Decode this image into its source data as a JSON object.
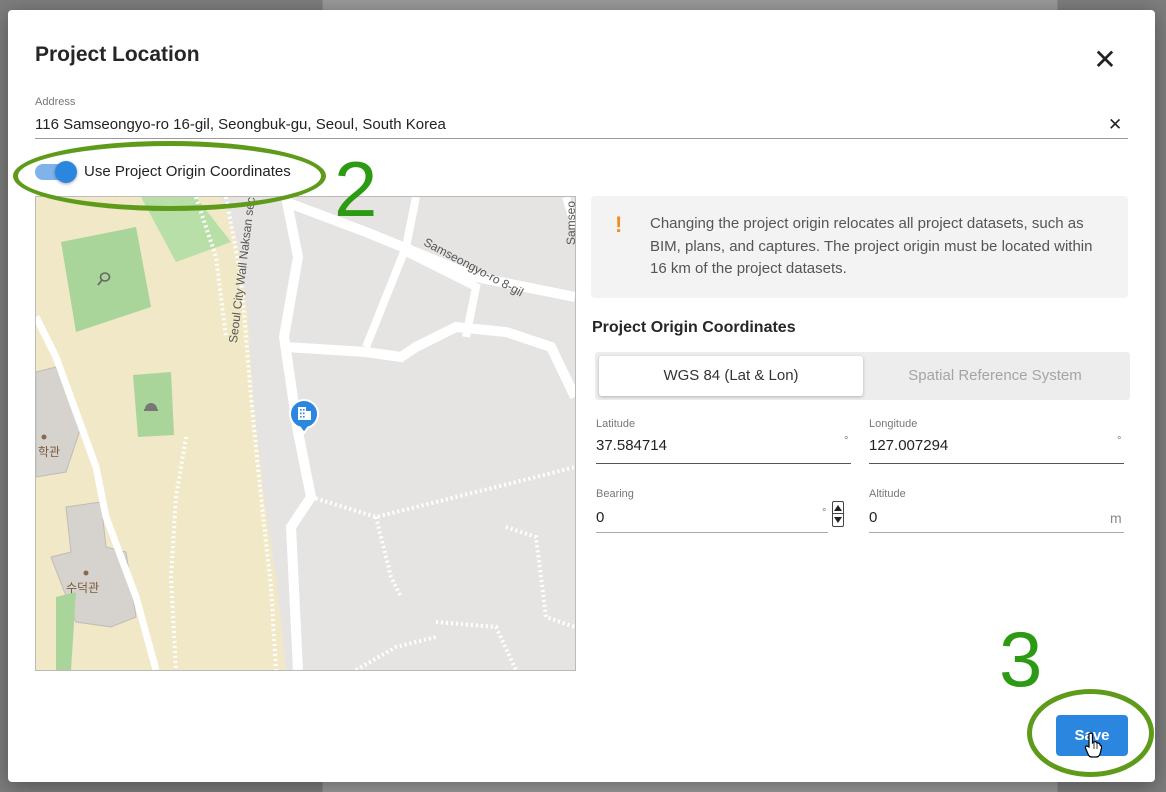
{
  "dialog": {
    "title": "Project Location",
    "close_symbol": "✕",
    "address": {
      "label": "Address",
      "value": "116 Samseongyo-ro 16-gil, Seongbuk-gu, Seoul, South Korea",
      "clear_symbol": "✕"
    },
    "toggle": {
      "label": "Use Project Origin Coordinates",
      "on": true
    },
    "map": {
      "labels": {
        "road_top": "Samseongyo-ro 8-gil",
        "road_side": "Seoul City Wall Naksan section",
        "road_edge": "Samseo",
        "building_1": "학관",
        "building_2": "수덕관"
      },
      "icons": [
        "tennis-icon",
        "helmet-icon",
        "office-building-pin-icon"
      ]
    },
    "info": {
      "icon": "!",
      "text": "Changing the project origin relocates all project datasets, such as BIM, plans, and captures. The project origin must be located within 16 km of the project datasets."
    },
    "coords": {
      "title": "Project Origin Coordinates",
      "tabs": [
        {
          "label": "WGS 84 (Lat & Lon)",
          "active": true
        },
        {
          "label": "Spatial Reference System",
          "active": false
        }
      ],
      "latitude": {
        "label": "Latitude",
        "value": "37.584714",
        "unit": "°"
      },
      "longitude": {
        "label": "Longitude",
        "value": "127.007294",
        "unit": "°"
      },
      "bearing": {
        "label": "Bearing",
        "value": "0",
        "unit": "°"
      },
      "altitude": {
        "label": "Altitude",
        "value": "0",
        "unit": "m"
      }
    },
    "save_label": "Save"
  },
  "annotations": {
    "step_2": "2",
    "step_3": "3",
    "color": "#5f9b1a"
  },
  "colors": {
    "primary": "#2b86e0",
    "warning": "#f28c28",
    "annotation_text": "#2d9a14"
  }
}
